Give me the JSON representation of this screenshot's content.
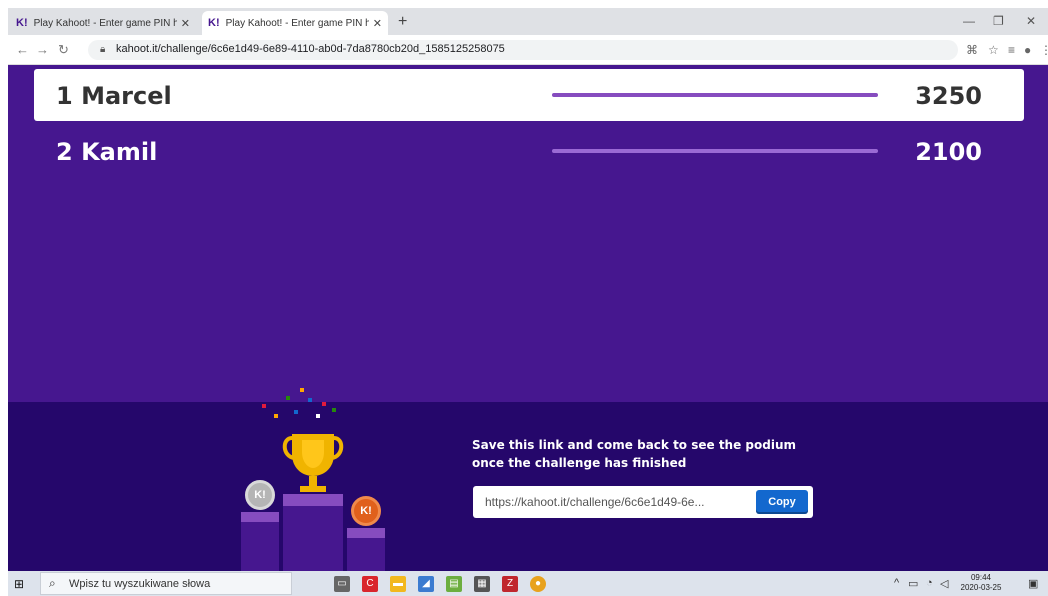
{
  "browser": {
    "tabs": [
      {
        "favicon": "K!",
        "title": "Play Kahoot! - Enter game PIN he",
        "close": "✕"
      },
      {
        "favicon": "K!",
        "title": "Play Kahoot! - Enter game PIN he",
        "close": "✕"
      }
    ],
    "new_tab": "+",
    "url": "kahoot.it/challenge/6c6e1d49-6e89-4110-ab0d-7da8780cb20d_1585125258075"
  },
  "leaderboard": [
    {
      "rank": "1",
      "name": "Marcel",
      "score": "3250"
    },
    {
      "rank": "2",
      "name": "Kamil",
      "score": "2100"
    }
  ],
  "footer": {
    "message": "Save this link and come back to see the podium once the challenge has finished",
    "link": "https://kahoot.it/challenge/6c6e1d49-6e...",
    "copy_label": "Copy"
  },
  "taskbar": {
    "search_placeholder": "Wpisz tu wyszukiwane słowa",
    "time": "09:44",
    "date": "2020-03-25"
  },
  "colors": {
    "brand_purple": "#46178f",
    "dark_purple": "#25076b",
    "copy_blue": "#1368ce"
  }
}
